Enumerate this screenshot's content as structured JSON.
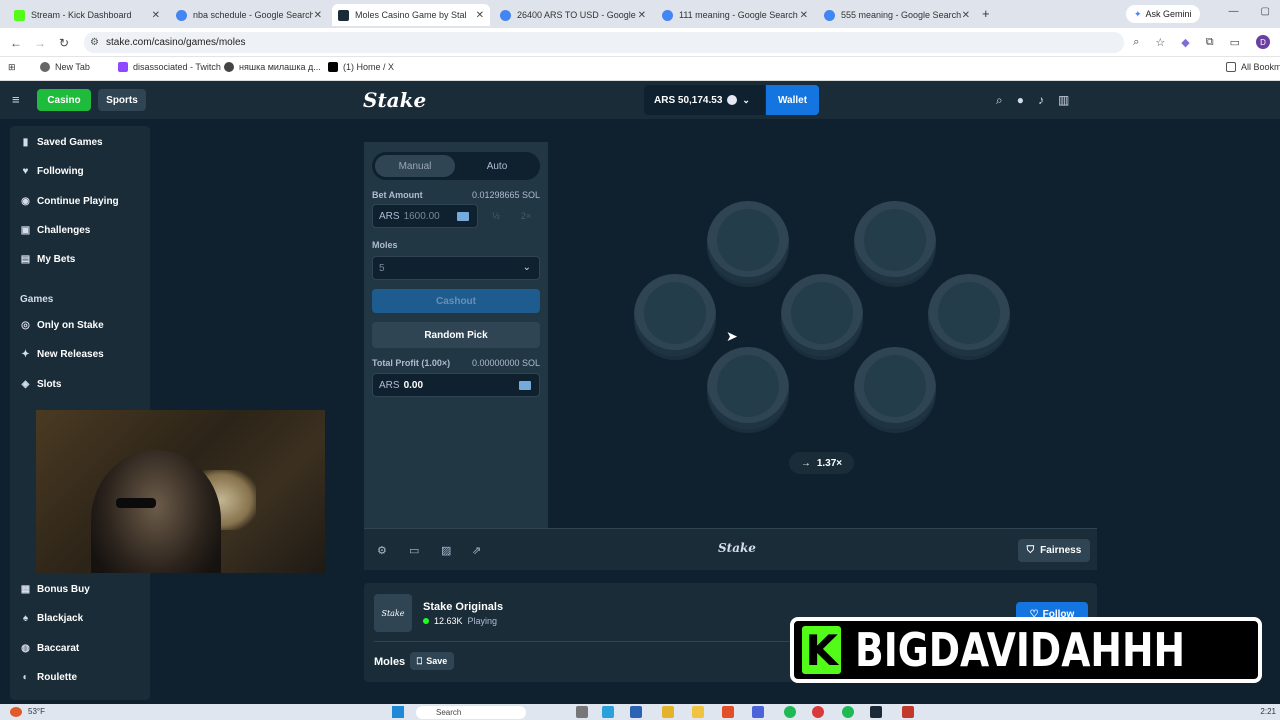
{
  "browser": {
    "tabs": [
      {
        "title": "Stream - Kick Dashboard",
        "color": "#53fc18",
        "active": false
      },
      {
        "title": "nba schedule - Google Search",
        "color": "#4285f4",
        "active": false
      },
      {
        "title": "Moles Casino Game by Stal",
        "color": "#1a2c38",
        "active": true
      },
      {
        "title": "26400 ARS TO USD - Google Se",
        "color": "#4285f4",
        "active": false
      },
      {
        "title": "111 meaning - Google Search",
        "color": "#4285f4",
        "active": false
      },
      {
        "title": "555 meaning - Google Search",
        "color": "#4285f4",
        "active": false
      }
    ],
    "ask_gemini": "Ask Gemini",
    "url": "stake.com/casino/games/moles",
    "profile_initial": "D",
    "bookmarks": [
      "New Tab",
      "disassociated - Twitch",
      "няшка милашка д...",
      "(1) Home / X"
    ],
    "all_bookmarks": "All Bookm"
  },
  "header": {
    "casino_label": "Casino",
    "sports_label": "Sports",
    "logo": "Stake",
    "balance": "ARS 50,174.53",
    "wallet_label": "Wallet"
  },
  "sidebar": {
    "items": [
      {
        "label": "Saved Games",
        "icon": "bookmark-icon"
      },
      {
        "label": "Following",
        "icon": "heart-icon"
      },
      {
        "label": "Continue Playing",
        "icon": "play-icon"
      },
      {
        "label": "Challenges",
        "icon": "trophy-icon"
      },
      {
        "label": "My Bets",
        "icon": "receipt-icon"
      }
    ],
    "games_heading": "Games",
    "games": [
      {
        "label": "Only on Stake",
        "icon": "star-icon"
      },
      {
        "label": "New Releases",
        "icon": "sparkle-icon"
      },
      {
        "label": "Slots",
        "icon": "slots-icon"
      }
    ],
    "more_games": [
      {
        "label": "Bonus Buy",
        "icon": "gift-icon"
      },
      {
        "label": "Blackjack",
        "icon": "cards-icon"
      },
      {
        "label": "Baccarat",
        "icon": "chip-icon"
      },
      {
        "label": "Roulette",
        "icon": "roulette-icon"
      }
    ]
  },
  "controls": {
    "mode_manual": "Manual",
    "mode_auto": "Auto",
    "bet_amount_label": "Bet Amount",
    "bet_amount_sol": "0.01298665 SOL",
    "bet_currency": "ARS",
    "bet_value": "1600.00",
    "half_label": "½",
    "double_label": "2×",
    "moles_label": "Moles",
    "moles_value": "5",
    "cashout_label": "Cashout",
    "random_pick_label": "Random Pick",
    "profit_label": "Total Profit (1.00×)",
    "profit_sol": "0.00000000 SOL",
    "profit_currency": "ARS",
    "profit_value": "0.00"
  },
  "board": {
    "multiplier": "1.37×",
    "holes": 7
  },
  "footer": {
    "logo": "Stake",
    "fairness_label": "Fairness"
  },
  "info": {
    "logo_text": "Stake",
    "title": "Stake Originals",
    "players": "12.63K",
    "players_label": "Playing",
    "follow_label": "Follow",
    "game_name": "Moles",
    "save_label": "Save"
  },
  "overlay": {
    "k": "K",
    "name": "BIGDAVIDAHHH"
  },
  "taskbar": {
    "weather": "53°F",
    "search": "Search",
    "time": "2:21"
  },
  "colors": {
    "accent_green": "#1fbb3c",
    "accent_blue": "#1475e1",
    "bg_dark": "#0f212e",
    "panel": "#213743",
    "kick_green": "#53fc18"
  }
}
